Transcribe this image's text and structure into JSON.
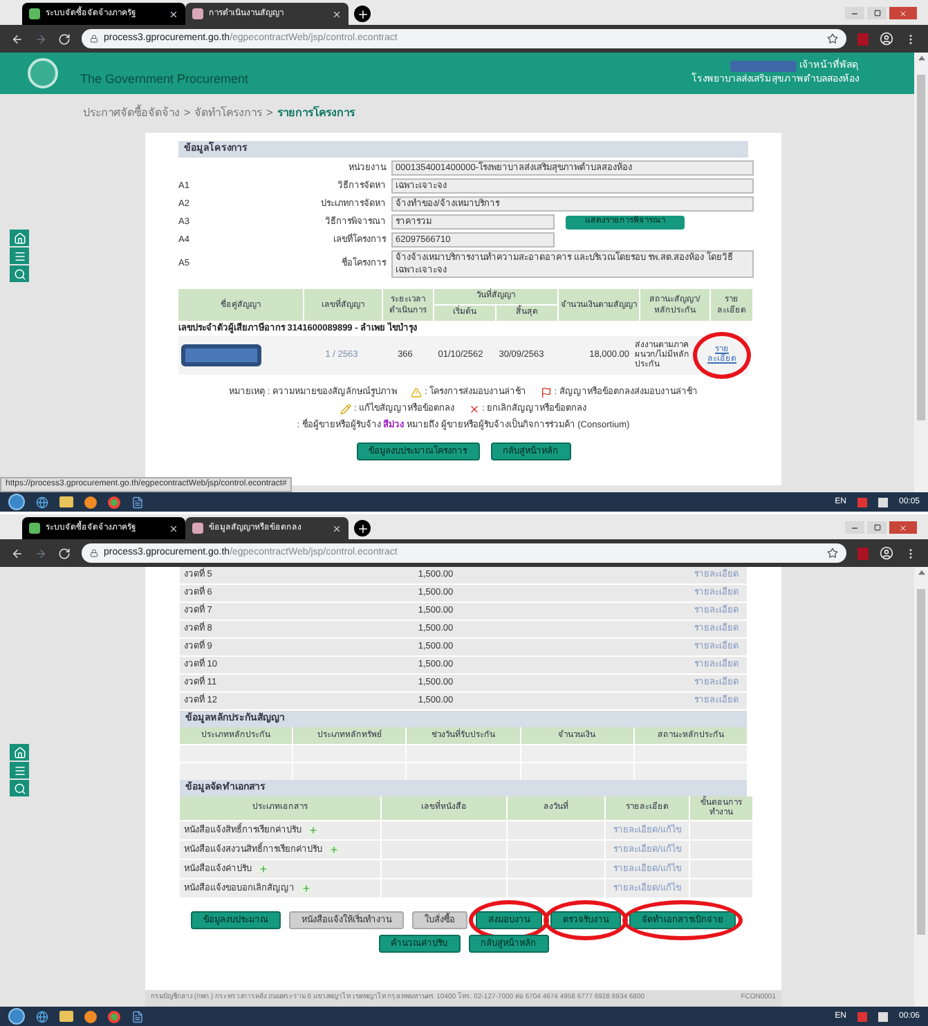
{
  "top_window": {
    "tabs": [
      {
        "title": "ระบบจัดซื้อจัดจ้างภาครัฐ",
        "selected": false
      },
      {
        "title": "การดำเนินงานสัญญา",
        "selected": true
      }
    ],
    "url": {
      "host": "process3.gprocurement.go.th",
      "path": "/egpecontractWeb/jsp/control.econtract"
    },
    "header": {
      "site_name": "The Government Procurement",
      "user_role": "เจ้าหน้าที่พัสดุ",
      "organization": "โรงพยาบาลส่งเสริมสุขภาพตำบลสองห้อง"
    },
    "breadcrumb": [
      {
        "label": "ประกาศจัดซื้อจัดจ้าง",
        "current": false
      },
      {
        "label": "จัดทำโครงการ",
        "current": false
      },
      {
        "label": "รายการโครงการ",
        "current": true
      }
    ],
    "breadcrumb_separators": [
      ">",
      ">"
    ],
    "project": {
      "title": "ข้อมูลโครงการ",
      "fields": [
        {
          "kind": "wide",
          "label": "หน่วยงาน",
          "value": "0001354001400000-โรงพยาบาลส่งเสริมสุขภาพตำบลสองห้อง"
        },
        {
          "kind": "wide",
          "code": "A1",
          "label": "วิธีการจัดหา",
          "value": "เฉพาะเจาะจง"
        },
        {
          "kind": "wide",
          "code": "A2",
          "label": "ประเภทการจัดหา",
          "value": "จ้างทำของ/จ้างเหมาบริการ"
        },
        {
          "kind": "short",
          "code": "A3",
          "label": "วิธีการพิจารณา",
          "value": "ราคารวม",
          "button": "แสดงรายการพิจารณา"
        },
        {
          "kind": "short",
          "code": "A4",
          "label": "เลขที่โครงการ",
          "value": "62097566710"
        },
        {
          "kind": "textarea",
          "code": "A5",
          "label": "ชื่อโครงการ",
          "value": "จ้างจ้างเหมาบริการงานทำความสะอาดอาคาร และบริเวณโดยรอบ รพ.สต.สองห้อง โดยวิธีเฉพาะเจาะจง"
        }
      ]
    },
    "contracts_table": {
      "columns": [
        {
          "label": "ชื่อคู่สัญญา"
        },
        {
          "label": "เลขที่สัญญา"
        },
        {
          "label": "ระยะเวลาดำเนินการ"
        },
        {
          "label": "วันที่สัญญา",
          "children": [
            {
              "label": "เริ่มต้น"
            },
            {
              "label": "สิ้นสุด"
            }
          ]
        },
        {
          "label": "จำนวนเงินตามสัญญา"
        },
        {
          "label": "สถานะสัญญา/หลักประกัน"
        },
        {
          "label": "รายละเอียด"
        }
      ],
      "groups": [
        {
          "title": "เลขประจำตัวผู้เสียภาษีอากร 3141600089899 - ลำเพย ไขบำรุง",
          "rows": [
            {
              "name_redacted": true,
              "contract_no": "1 / 2563",
              "duration": "366",
              "start": "01/10/2562",
              "end": "30/09/2563",
              "amount": "18,000.00",
              "status": "ส่งงานตามภาคผนวก/ไม่มีหลักประกัน",
              "detail": {
                "label": "รายละเอียด",
                "highlighted": true
              }
            }
          ]
        }
      ]
    },
    "legend": {
      "title": "หมายเหตุ : ความหมายของสัญลักษณ์รูปภาพ",
      "items": [
        {
          "kind": "warning",
          "label": ": โครงการส่งมอบงานล่าช้า"
        },
        {
          "kind": "flag",
          "label": ": สัญญาหรือข้อตกลงส่งมอบงานล่าช้า"
        },
        {
          "kind": "pencil",
          "label": ": แก้ไขสัญญาหรือข้อตกลง"
        },
        {
          "kind": "cancel",
          "label": ": ยกเลิกสัญญาหรือข้อตกลง"
        }
      ],
      "note": {
        "before": ": ชื่อผู้ขายหรือผู้รับจ้าง",
        "emphasis": "สีม่วง",
        "after": "หมายถึง ผู้ขายหรือผู้รับจ้างเป็นกิจการร่วมค้า (Consortium)"
      }
    },
    "buttons": [
      {
        "label": "ข้อมูลงบประมาณโครงการ"
      },
      {
        "label": "กลับสู่หน้าหลัก"
      }
    ],
    "status_url": "https://process3.gprocurement.go.th/egpecontractWeb/jsp/control.econtract#",
    "taskbar": {
      "language": "EN",
      "clock": "00:05"
    }
  },
  "bottom_window": {
    "tabs": [
      {
        "title": "ระบบจัดซื้อจัดจ้างภาครัฐ",
        "selected": false
      },
      {
        "title": "ข้อมูลสัญญาหรือข้อตกลง",
        "selected": true
      }
    ],
    "url": {
      "host": "process3.gprocurement.go.th",
      "path": "/egpecontractWeb/jsp/control.econtract"
    },
    "installments": [
      {
        "label": "งวดที่ 5",
        "amount": "1,500.00",
        "link": "รายละเอียด"
      },
      {
        "label": "งวดที่ 6",
        "amount": "1,500.00",
        "link": "รายละเอียด"
      },
      {
        "label": "งวดที่ 7",
        "amount": "1,500.00",
        "link": "รายละเอียด"
      },
      {
        "label": "งวดที่ 8",
        "amount": "1,500.00",
        "link": "รายละเอียด"
      },
      {
        "label": "งวดที่ 9",
        "amount": "1,500.00",
        "link": "รายละเอียด"
      },
      {
        "label": "งวดที่ 10",
        "amount": "1,500.00",
        "link": "รายละเอียด"
      },
      {
        "label": "งวดที่ 11",
        "amount": "1,500.00",
        "link": "รายละเอียด"
      },
      {
        "label": "งวดที่ 12",
        "amount": "1,500.00",
        "link": "รายละเอียด"
      }
    ],
    "guarantee": {
      "title": "ข้อมูลหลักประกันสัญญา",
      "columns": [
        "ประเภทหลักประกัน",
        "ประเภทหลักทรัพย์",
        "ช่วงวันที่รับประกัน",
        "จำนวนเงิน",
        "สถานะหลักประกัน"
      ]
    },
    "documents": {
      "title": "ข้อมูลจัดทำเอกสาร",
      "columns": [
        "ประเภทเอกสาร",
        "เลขที่หนังสือ",
        "ลงวันที่",
        "รายละเอียด",
        "ขั้นตอนการทำงาน"
      ],
      "rows": [
        {
          "type": "หนังสือแจ้งสิทธิ์การเรียกค่าปรับ",
          "detail": "รายละเอียด/แก้ไข"
        },
        {
          "type": "หนังสือแจ้งสงวนสิทธิ์การเรียกค่าปรับ",
          "detail": "รายละเอียด/แก้ไข"
        },
        {
          "type": "หนังสือแจ้งค่าปรับ",
          "detail": "รายละเอียด/แก้ไข"
        },
        {
          "type": "หนังสือแจ้งขอบอกเลิกสัญญา",
          "detail": "รายละเอียด/แก้ไข"
        }
      ]
    },
    "button_rows": [
      [
        {
          "label": "ข้อมูลงบประมาณ",
          "kind": "primary",
          "highlighted": false
        },
        {
          "label": "หนังสือแจ้งให้เริ่มทำงาน",
          "kind": "secondary",
          "highlighted": false
        },
        {
          "label": "ใบสั่งซื้อ",
          "kind": "secondary",
          "highlighted": false
        },
        {
          "label": "ส่งมอบงาน",
          "kind": "primary",
          "highlighted": true
        },
        {
          "label": "ตรวจรับงาน",
          "kind": "primary",
          "highlighted": true
        },
        {
          "label": "จัดทำเอกสารเบิกจ่าย",
          "kind": "primary",
          "highlighted": true
        }
      ],
      [
        {
          "label": "คำนวณค่าปรับ",
          "kind": "primary",
          "highlighted": false
        },
        {
          "label": "กลับสู่หน้าหลัก",
          "kind": "primary",
          "highlighted": false
        }
      ]
    ],
    "footer": "กรมบัญชีกลาง (กพก.) กระทรวงการคลัง ถนนพระราม 6 แขวงพญาไท เขตพญาไท กรุงเทพมหานคร 10400 โทร. 02-127-7000 ต่อ 6704 4674 4958 6777 6928 6934 6800",
    "footer_code": "FCON0001",
    "taskbar": {
      "language": "EN",
      "clock": "00:06"
    }
  }
}
